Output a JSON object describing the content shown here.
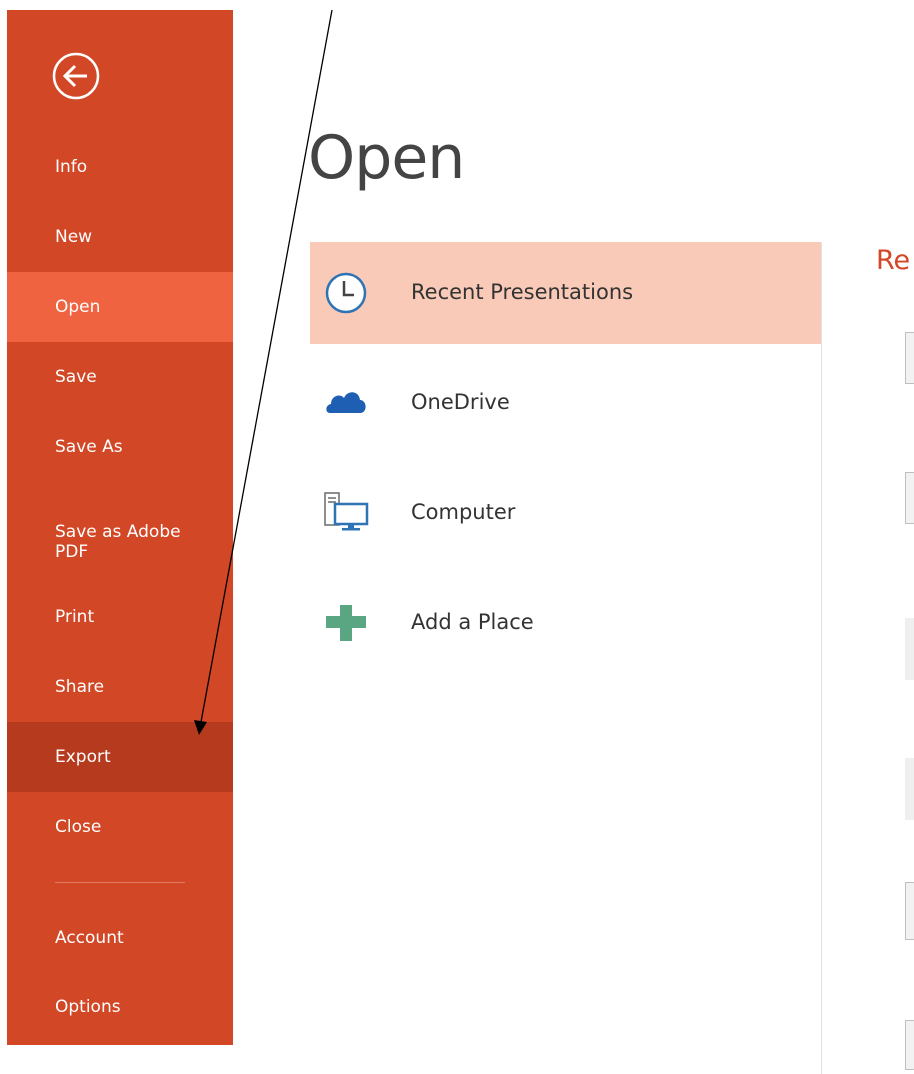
{
  "sidebar": {
    "items": [
      {
        "label": "Info"
      },
      {
        "label": "New"
      },
      {
        "label": "Open"
      },
      {
        "label": "Save"
      },
      {
        "label": "Save As"
      },
      {
        "label": "Save as Adobe PDF"
      },
      {
        "label": "Print"
      },
      {
        "label": "Share"
      },
      {
        "label": "Export"
      },
      {
        "label": "Close"
      },
      {
        "label": "Account"
      },
      {
        "label": "Options"
      }
    ],
    "active": "Open",
    "hovered": "Export"
  },
  "main": {
    "title": "Open",
    "places": [
      {
        "label": "Recent Presentations",
        "icon": "clock-icon"
      },
      {
        "label": "OneDrive",
        "icon": "cloud-icon"
      },
      {
        "label": "Computer",
        "icon": "computer-icon"
      },
      {
        "label": "Add a Place",
        "icon": "plus-icon"
      }
    ],
    "recent_heading": "Re"
  },
  "colors": {
    "brand": "#d24726",
    "active": "#ef6340",
    "hover": "#b63a1d",
    "selected_place": "#f9cab7"
  }
}
